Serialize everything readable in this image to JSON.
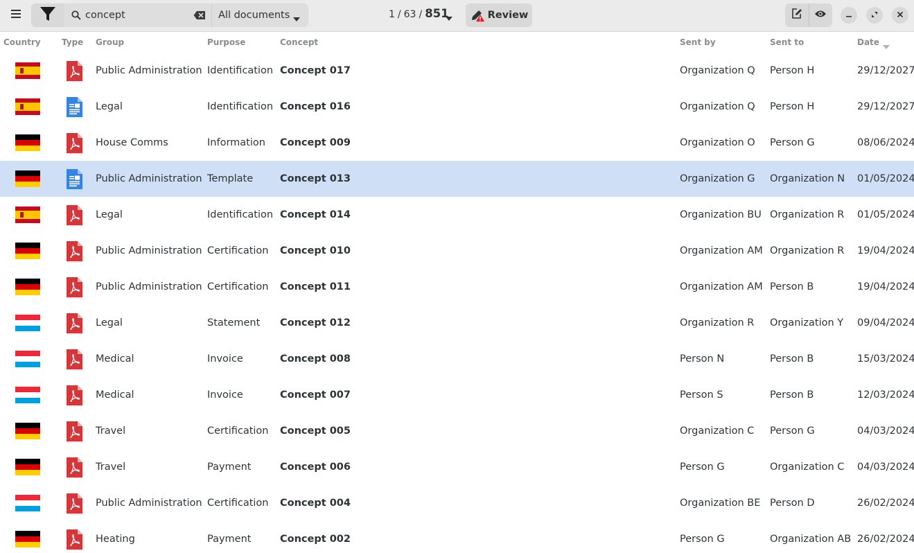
{
  "toolbar": {
    "search_value": "concept",
    "search_placeholder": "Search",
    "scope_label": "All documents",
    "pager_current": "1",
    "pager_pages": "63",
    "pager_total": "851",
    "pager_sep": "/",
    "review_label": "Review"
  },
  "columns": {
    "country": "Country",
    "type": "Type",
    "group": "Group",
    "purpose": "Purpose",
    "concept": "Concept",
    "sent_by": "Sent by",
    "sent_to": "Sent to",
    "date": "Date"
  },
  "flag_colors": {
    "es": [
      "#c60b1e",
      "#ffc400",
      "#c60b1e"
    ],
    "de": [
      "#000000",
      "#dd0000",
      "#ffce00"
    ],
    "lu": [
      "#ed2939",
      "#ffffff",
      "#00a1de"
    ]
  },
  "icons": {
    "pdf": "pdf-file-icon",
    "doc": "text-document-icon"
  },
  "rows": [
    {
      "country": "es",
      "type": "pdf",
      "group": "Public Administration",
      "purpose": "Identification",
      "concept": "Concept 017",
      "sent_by": "Organization Q",
      "sent_to": "Person H",
      "date": "29/12/2027",
      "selected": false
    },
    {
      "country": "es",
      "type": "doc",
      "group": "Legal",
      "purpose": "Identification",
      "concept": "Concept 016",
      "sent_by": "Organization Q",
      "sent_to": "Person H",
      "date": "29/12/2027",
      "selected": false
    },
    {
      "country": "de",
      "type": "pdf",
      "group": "House Comms",
      "purpose": "Information",
      "concept": "Concept 009",
      "sent_by": "Organization O",
      "sent_to": "Person G",
      "date": "08/06/2024",
      "selected": false
    },
    {
      "country": "de",
      "type": "doc",
      "group": "Public Administration",
      "purpose": "Template",
      "concept": "Concept 013",
      "sent_by": "Organization G",
      "sent_to": "Organization N",
      "date": "01/05/2024",
      "selected": true
    },
    {
      "country": "es",
      "type": "pdf",
      "group": "Legal",
      "purpose": "Identification",
      "concept": "Concept 014",
      "sent_by": "Organization BU",
      "sent_to": "Organization R",
      "date": "01/05/2024",
      "selected": false
    },
    {
      "country": "de",
      "type": "pdf",
      "group": "Public Administration",
      "purpose": "Certification",
      "concept": "Concept 010",
      "sent_by": "Organization AM",
      "sent_to": "Organization R",
      "date": "19/04/2024",
      "selected": false
    },
    {
      "country": "de",
      "type": "pdf",
      "group": "Public Administration",
      "purpose": "Certification",
      "concept": "Concept 011",
      "sent_by": "Organization AM",
      "sent_to": "Person B",
      "date": "19/04/2024",
      "selected": false
    },
    {
      "country": "lu",
      "type": "pdf",
      "group": "Legal",
      "purpose": "Statement",
      "concept": "Concept 012",
      "sent_by": "Organization R",
      "sent_to": "Organization Y",
      "date": "09/04/2024",
      "selected": false
    },
    {
      "country": "lu",
      "type": "pdf",
      "group": "Medical",
      "purpose": "Invoice",
      "concept": "Concept 008",
      "sent_by": "Person N",
      "sent_to": "Person B",
      "date": "15/03/2024",
      "selected": false
    },
    {
      "country": "lu",
      "type": "pdf",
      "group": "Medical",
      "purpose": "Invoice",
      "concept": "Concept 007",
      "sent_by": "Person S",
      "sent_to": "Person B",
      "date": "12/03/2024",
      "selected": false
    },
    {
      "country": "de",
      "type": "pdf",
      "group": "Travel",
      "purpose": "Certification",
      "concept": "Concept 005",
      "sent_by": "Organization C",
      "sent_to": "Person G",
      "date": "04/03/2024",
      "selected": false
    },
    {
      "country": "de",
      "type": "pdf",
      "group": "Travel",
      "purpose": "Payment",
      "concept": "Concept 006",
      "sent_by": "Person G",
      "sent_to": "Organization C",
      "date": "04/03/2024",
      "selected": false
    },
    {
      "country": "lu",
      "type": "pdf",
      "group": "Public Administration",
      "purpose": "Certification",
      "concept": "Concept 004",
      "sent_by": "Organization BE",
      "sent_to": "Person D",
      "date": "26/02/2024",
      "selected": false
    },
    {
      "country": "de",
      "type": "pdf",
      "group": "Heating",
      "purpose": "Payment",
      "concept": "Concept 002",
      "sent_by": "Person G",
      "sent_to": "Organization AB",
      "date": "26/02/2024",
      "selected": false
    }
  ]
}
